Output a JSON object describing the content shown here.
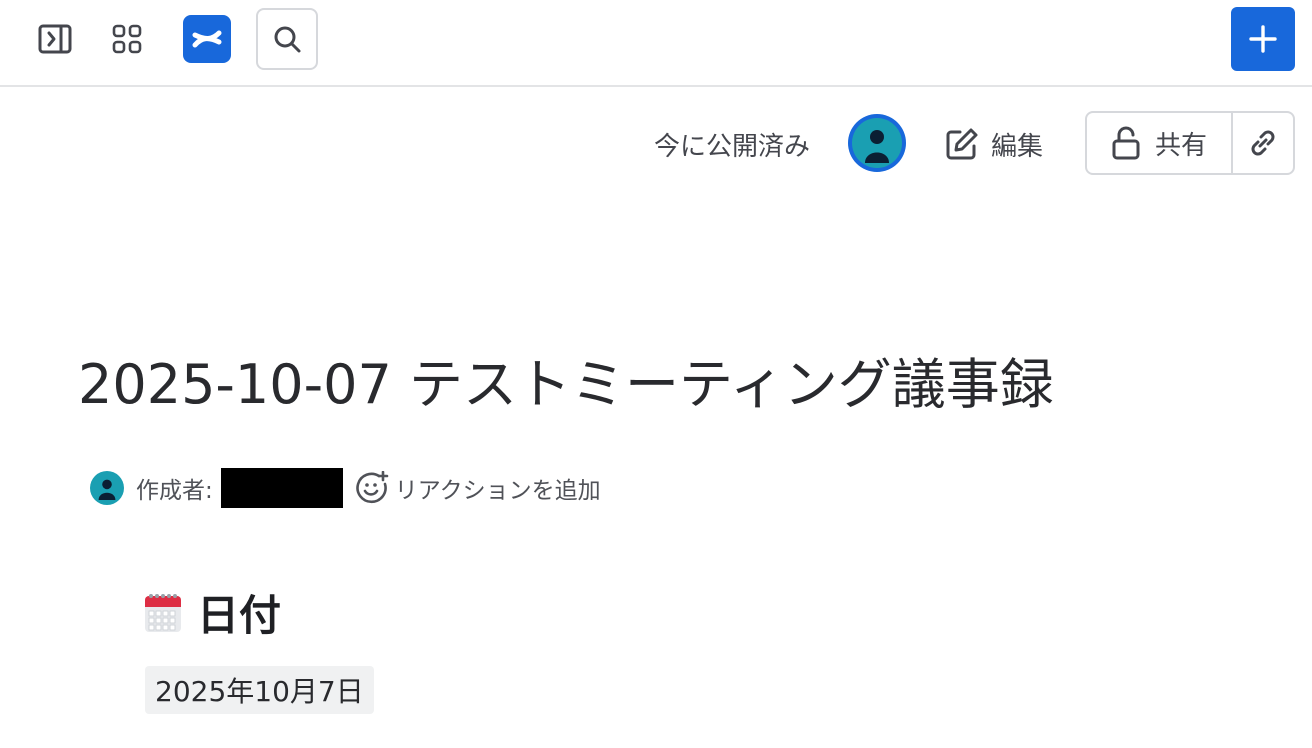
{
  "topbar": {
    "sidebar_toggle": "sidebar-expand-icon",
    "app_switcher": "app-switcher-icon",
    "logo": "confluence-logo",
    "search": "search-icon",
    "create": "plus-icon"
  },
  "header": {
    "published_status": "今に公開済み",
    "edit_label": "編集",
    "share_label": "共有"
  },
  "page": {
    "title": "2025-10-07 テストミーティング議事録",
    "author_label": "作成者:",
    "reaction_label": "リアクションを追加"
  },
  "section": {
    "heading": "日付",
    "date_value": "2025年10月7日"
  },
  "colors": {
    "brand": "#1868db",
    "avatar": "#1a9fb2"
  }
}
